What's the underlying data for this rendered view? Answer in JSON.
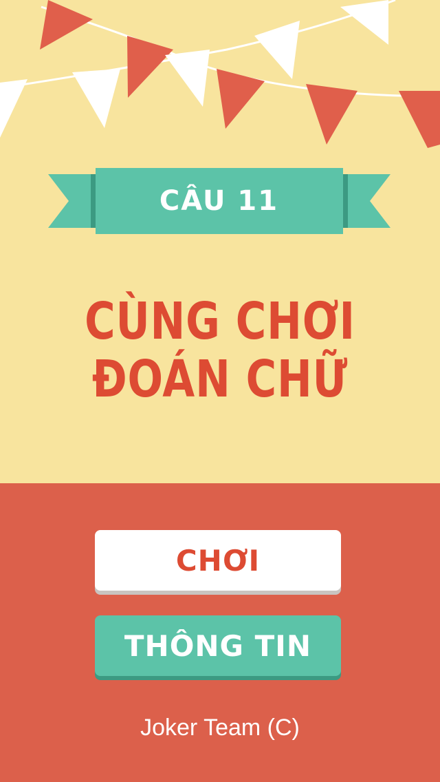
{
  "header": {
    "level_label": "CÂU 11"
  },
  "title": {
    "line1": "CÙNG CHƠI",
    "line2": "ĐOÁN CHỮ"
  },
  "buttons": {
    "play_label": "CHƠI",
    "info_label": "THÔNG TIN"
  },
  "footer": {
    "credit": "Joker Team (C)"
  },
  "colors": {
    "background_top": "#f8e49e",
    "background_bottom": "#dc604b",
    "accent_red": "#dd4b33",
    "accent_teal": "#5cc3a8",
    "flag_red": "#e05f4b",
    "flag_white": "#ffffff"
  },
  "icons": [
    "bunting-flags-decoration",
    "ribbon-banner"
  ]
}
